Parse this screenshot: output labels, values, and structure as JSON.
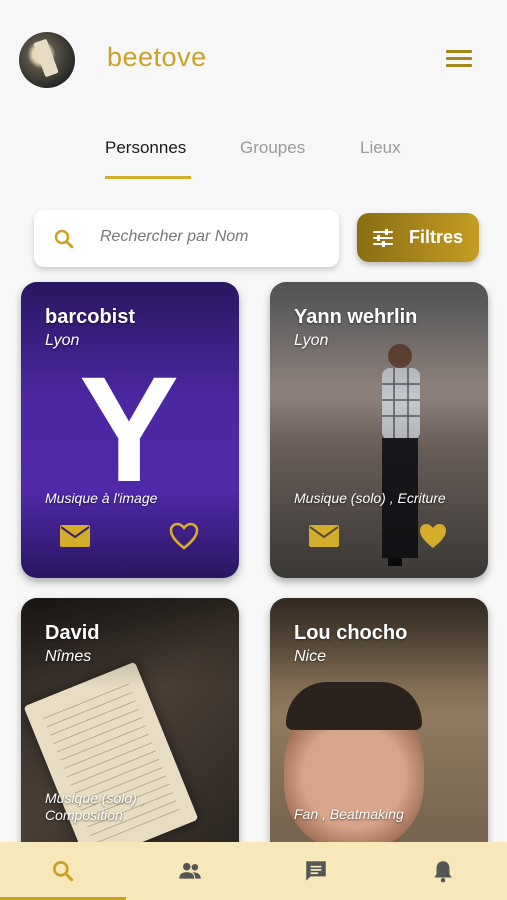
{
  "header": {
    "app_title": "beetove",
    "avatar": "user-avatar",
    "menu_icon": "hamburger-menu-icon"
  },
  "tabs": [
    {
      "label": "Personnes",
      "active": true
    },
    {
      "label": "Groupes",
      "active": false
    },
    {
      "label": "Lieux",
      "active": false
    }
  ],
  "search": {
    "placeholder": "Rechercher par Nom",
    "value": "",
    "icon": "search-icon"
  },
  "filter": {
    "label": "Filtres",
    "icon": "sliders-icon"
  },
  "cards": [
    {
      "name": "barcobist",
      "city": "Lyon",
      "tags": "Musique à l'image",
      "favorite": false,
      "image": "purple-Y-logo"
    },
    {
      "name": "Yann wehrlin",
      "city": "Lyon",
      "tags": "Musique (solo) , Ecriture",
      "favorite": true,
      "image": "man-on-street-photo"
    },
    {
      "name": "David",
      "city": "Nîmes",
      "tags": "Musique (solo) , Composition",
      "favorite": false,
      "image": "sheet-music-book-photo"
    },
    {
      "name": "Lou chocho",
      "city": "Nice",
      "tags": "Fan , Beatmaking",
      "favorite": false,
      "image": "selfie-photo"
    }
  ],
  "bottom_nav": [
    {
      "icon": "search-icon",
      "active": true
    },
    {
      "icon": "people-icon",
      "active": false
    },
    {
      "icon": "chat-icon",
      "active": false
    },
    {
      "icon": "bell-icon",
      "active": false
    }
  ],
  "colors": {
    "accent": "#c9a227",
    "nav_bg": "#f6e8b8",
    "card1_bg": "#4c27a2"
  }
}
